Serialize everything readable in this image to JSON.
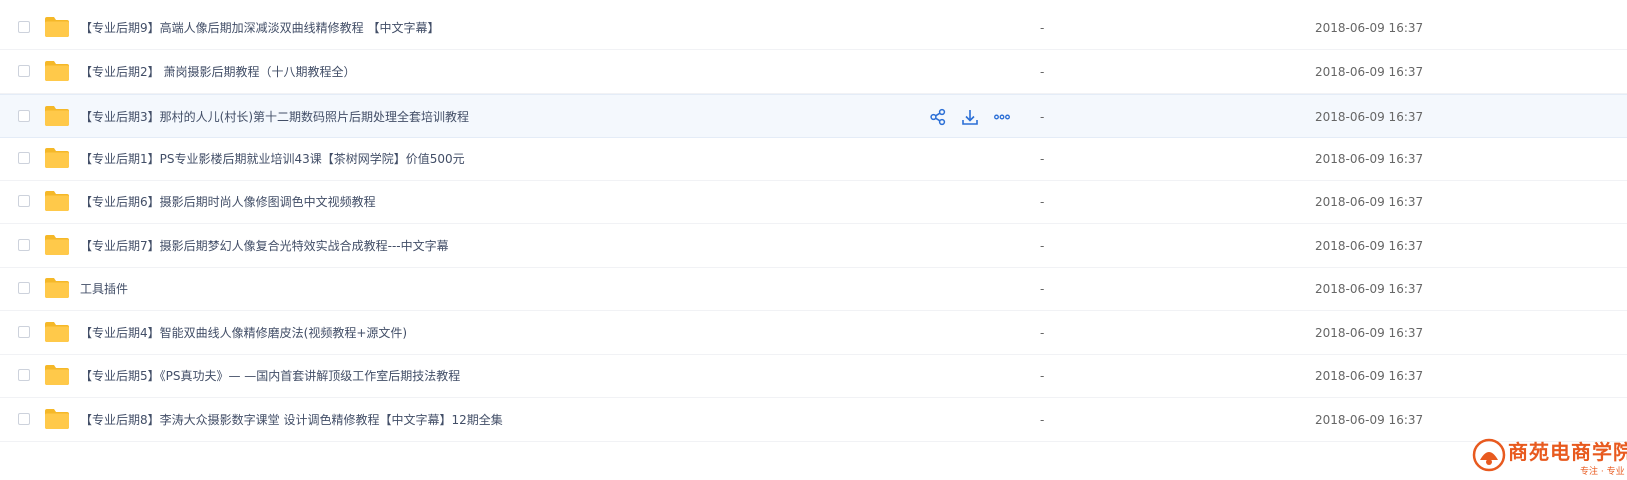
{
  "rows": [
    {
      "name": "【专业后期9】高端人像后期加深减淡双曲线精修教程 【中文字幕】",
      "size": "-",
      "date": "2018-06-09 16:37"
    },
    {
      "name": "【专业后期2】 萧岗摄影后期教程（十八期教程全）",
      "size": "-",
      "date": "2018-06-09 16:37"
    },
    {
      "name": "【专业后期3】那村的人儿(村长)第十二期数码照片后期处理全套培训教程",
      "size": "-",
      "date": "2018-06-09 16:37"
    },
    {
      "name": "【专业后期1】PS专业影楼后期就业培训43课【茶树网学院】价值500元",
      "size": "-",
      "date": "2018-06-09 16:37"
    },
    {
      "name": "【专业后期6】摄影后期时尚人像修图调色中文视频教程",
      "size": "-",
      "date": "2018-06-09 16:37"
    },
    {
      "name": "【专业后期7】摄影后期梦幻人像复合光特效实战合成教程---中文字幕",
      "size": "-",
      "date": "2018-06-09 16:37"
    },
    {
      "name": "工具插件",
      "size": "-",
      "date": "2018-06-09 16:37"
    },
    {
      "name": "【专业后期4】智能双曲线人像精修磨皮法(视频教程+源文件)",
      "size": "-",
      "date": "2018-06-09 16:37"
    },
    {
      "name": "【专业后期5】《PS真功夫》— —国内首套讲解顶级工作室后期技法教程",
      "size": "-",
      "date": "2018-06-09 16:37"
    },
    {
      "name": "【专业后期8】李涛大众摄影数字课堂 设计调色精修教程【中文字幕】12期全集",
      "size": "-",
      "date": "2018-06-09 16:37"
    }
  ],
  "hover_row_index": 2,
  "row_actions": [
    "share-icon",
    "download-icon",
    "more-icon"
  ],
  "watermark": {
    "title": "商苑电商学院",
    "subtitle": "专注 · 专业"
  },
  "colors": {
    "folder": "#ffc94a",
    "folder_dark": "#f5b828",
    "accent": "#2b6fd6",
    "watermark": "#e85a1f"
  }
}
